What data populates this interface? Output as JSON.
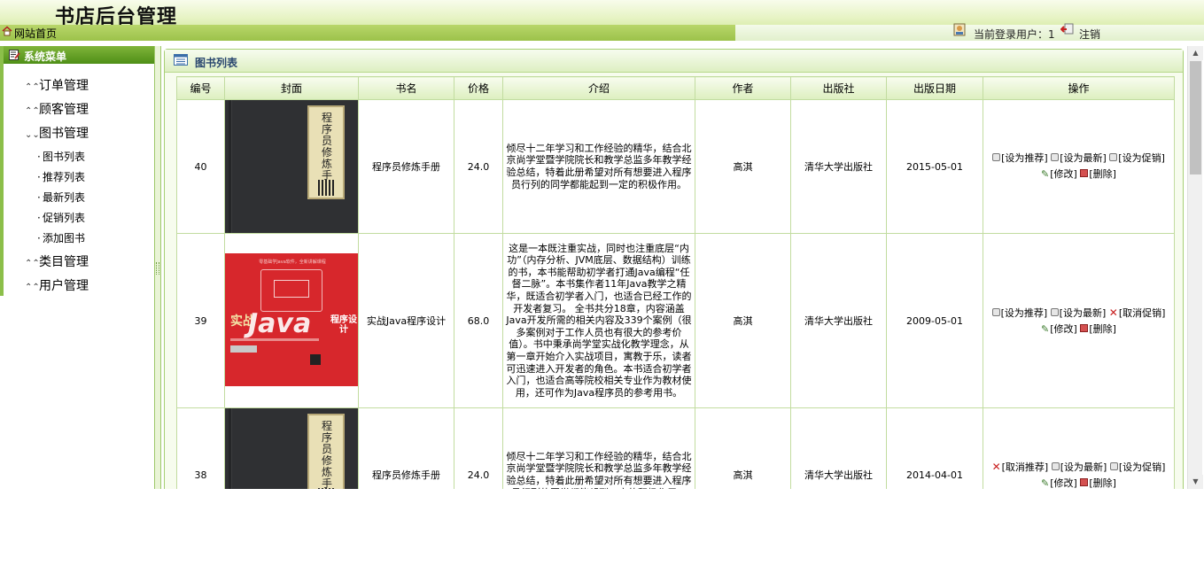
{
  "header": {
    "title": "书店后台管理",
    "home_link": "网站首页",
    "current_user_label": "当前登录用户：1",
    "logout": "注销"
  },
  "sidebar": {
    "title": "系统菜单",
    "items": [
      {
        "label": "订单管理",
        "expanded": false
      },
      {
        "label": "顾客管理",
        "expanded": false
      },
      {
        "label": "图书管理",
        "expanded": true
      },
      {
        "label": "类目管理",
        "expanded": false
      },
      {
        "label": "用户管理",
        "expanded": false
      }
    ],
    "book_sub_items": [
      "图书列表",
      "推荐列表",
      "最新列表",
      "促销列表",
      "添加图书"
    ]
  },
  "panel": {
    "title": "图书列表"
  },
  "table": {
    "headers": [
      "编号",
      "封面",
      "书名",
      "价格",
      "介绍",
      "作者",
      "出版社",
      "出版日期",
      "操作"
    ],
    "rows": [
      {
        "id": "40",
        "cover": "程序员修炼手册",
        "name": "程序员修炼手册",
        "price": "24.0",
        "intro": "倾尽十二年学习和工作经验的精华，结合北京尚学堂暨学院院长和教学总监多年教学经验总结，特着此册希望对所有想要进入程序员行列的同学都能起到一定的积极作用。",
        "author": "高淇",
        "publisher": "清华大学出版社",
        "date": "2015-05-01",
        "ops": {
          "recommend": "[设为推荐]",
          "newest": "[设为最新]",
          "promo": "[设为促销]",
          "edit": "[修改]",
          "delete": "[删除]"
        }
      },
      {
        "id": "39",
        "cover": "实战Java程序设计",
        "name": "实战Java程序设计",
        "price": "68.0",
        "intro": "这是一本既注重实战，同时也注重底层“内功”（内存分析、JVM底层、数据结构）训练的书，本书能帮助初学者打通Java编程“任督二脉”。本书集作者11年Java教学之精华，既适合初学者入门，也适合已经工作的开发者复习。 全书共分18章，内容涵盖Java开发所需的相关内容及339个案例（很多案例对于工作人员也有很大的参考价值）。书中秉承尚学堂实战化教学理念，从第一章开始介入实战项目，寓教于乐，读者可迅速进入开发者的角色。本书适合初学者入门，也适合高等院校相关专业作为教材使用，还可作为Java程序员的参考用书。",
        "author": "高淇",
        "publisher": "清华大学出版社",
        "date": "2009-05-01",
        "ops": {
          "recommend": "[设为推荐]",
          "newest": "[设为最新]",
          "promo": "[取消促销]",
          "edit": "[修改]",
          "delete": "[删除]"
        }
      },
      {
        "id": "38",
        "cover": "程序员修炼手册",
        "name": "程序员修炼手册",
        "price": "24.0",
        "intro": "倾尽十二年学习和工作经验的精华，结合北京尚学堂暨学院院长和教学总监多年教学经验总结，特着此册希望对所有想要进入程序员行列的同学都能起到一定的积极作用。",
        "author": "高淇",
        "publisher": "清华大学出版社",
        "date": "2014-04-01",
        "ops": {
          "recommend": "[取消推荐]",
          "newest": "[设为最新]",
          "promo": "[设为促销]",
          "edit": "[修改]",
          "delete": "[删除]"
        }
      }
    ]
  },
  "cover_art": {
    "java_small_text": "零基础学Java软件，全新讲解课程",
    "java_logo": "Java",
    "java_accent": "实战",
    "java_subtitle": "程序设计"
  },
  "colors": {
    "header_green": "#c9e38a",
    "sidebar_head": "#4f8f17",
    "panel_border": "#a7cf75",
    "link_blue": "#15507a",
    "cancel_red": "#c81e1e"
  },
  "icons": {
    "home": "home-icon",
    "user": "user-icon",
    "logout": "logout-icon",
    "menu": "menu-edit-icon",
    "list": "list-icon"
  }
}
